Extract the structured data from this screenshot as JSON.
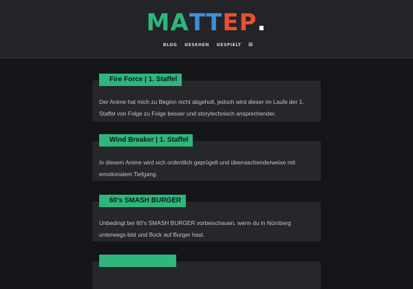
{
  "header": {
    "logo_letters": [
      {
        "char": "M",
        "color": "#2eb67d"
      },
      {
        "char": "A",
        "color": "#2eb67d"
      },
      {
        "char": "T",
        "color": "#3b8fd9"
      },
      {
        "char": "T",
        "color": "#3b8fd9"
      },
      {
        "char": "E",
        "color": "#e8502f"
      },
      {
        "char": "P",
        "color": "#e8502f"
      },
      {
        "char": ".",
        "color": "#ffffff"
      }
    ],
    "nav": {
      "items": [
        "BLOG",
        "GESEHEN",
        "GESPIELT"
      ],
      "menu_icon": "hamburger-icon"
    }
  },
  "posts": [
    {
      "title": "Fire Force | 1. Staffel",
      "text": "Der Anime hat mich zu Beginn nicht abgeholt, jedoch wird dieser im Laufe der 1. Staffel von Folge zu Folge besser und storytechnisch ansprechender."
    },
    {
      "title": "Wind Breaker | 1. Staffel",
      "text": "In diesem Anime wird sich ordentlich geprügelt und überraschenderweise mit emotionalem Tiefgang."
    },
    {
      "title": "60’s SMASH BURGER",
      "text": "Unbedingt bei 60’s SMASH BURGER vorbeischauen, wenn du in Nürnberg unterwegs bist und Bock auf Burger hast."
    },
    {
      "title": "",
      "text": ""
    }
  ],
  "colors": {
    "accent": "#2eb67d",
    "background": "#141518",
    "header": "#232427",
    "card": "#26272b"
  }
}
